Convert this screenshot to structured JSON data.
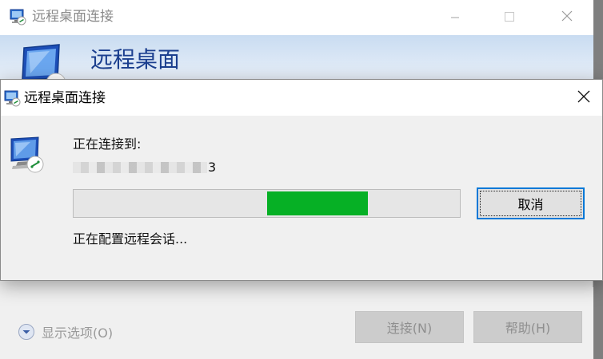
{
  "background_window": {
    "title": "远程桌面连接",
    "banner_title": "远程桌面",
    "show_options_label": "显示选项(O)",
    "connect_label": "连接(N)",
    "help_label": "帮助(H)"
  },
  "dialog": {
    "title": "远程桌面连接",
    "connecting_label": "正在连接到:",
    "server_address_visible_tail": "3",
    "progress_fraction": 0.26,
    "progress_offset_fraction": 0.5,
    "cancel_label": "取消",
    "status_text": "正在配置远程会话..."
  },
  "icons": {
    "window_icon": "remote-desktop-icon",
    "close_icon": "close-icon",
    "minimize_icon": "minimize-icon",
    "maximize_icon": "maximize-icon",
    "show_options_icon": "chevron-down-circle-icon"
  },
  "colors": {
    "progress_fill": "#06b025",
    "banner_title": "#1b3f8f",
    "focus_border": "#0078d7"
  }
}
